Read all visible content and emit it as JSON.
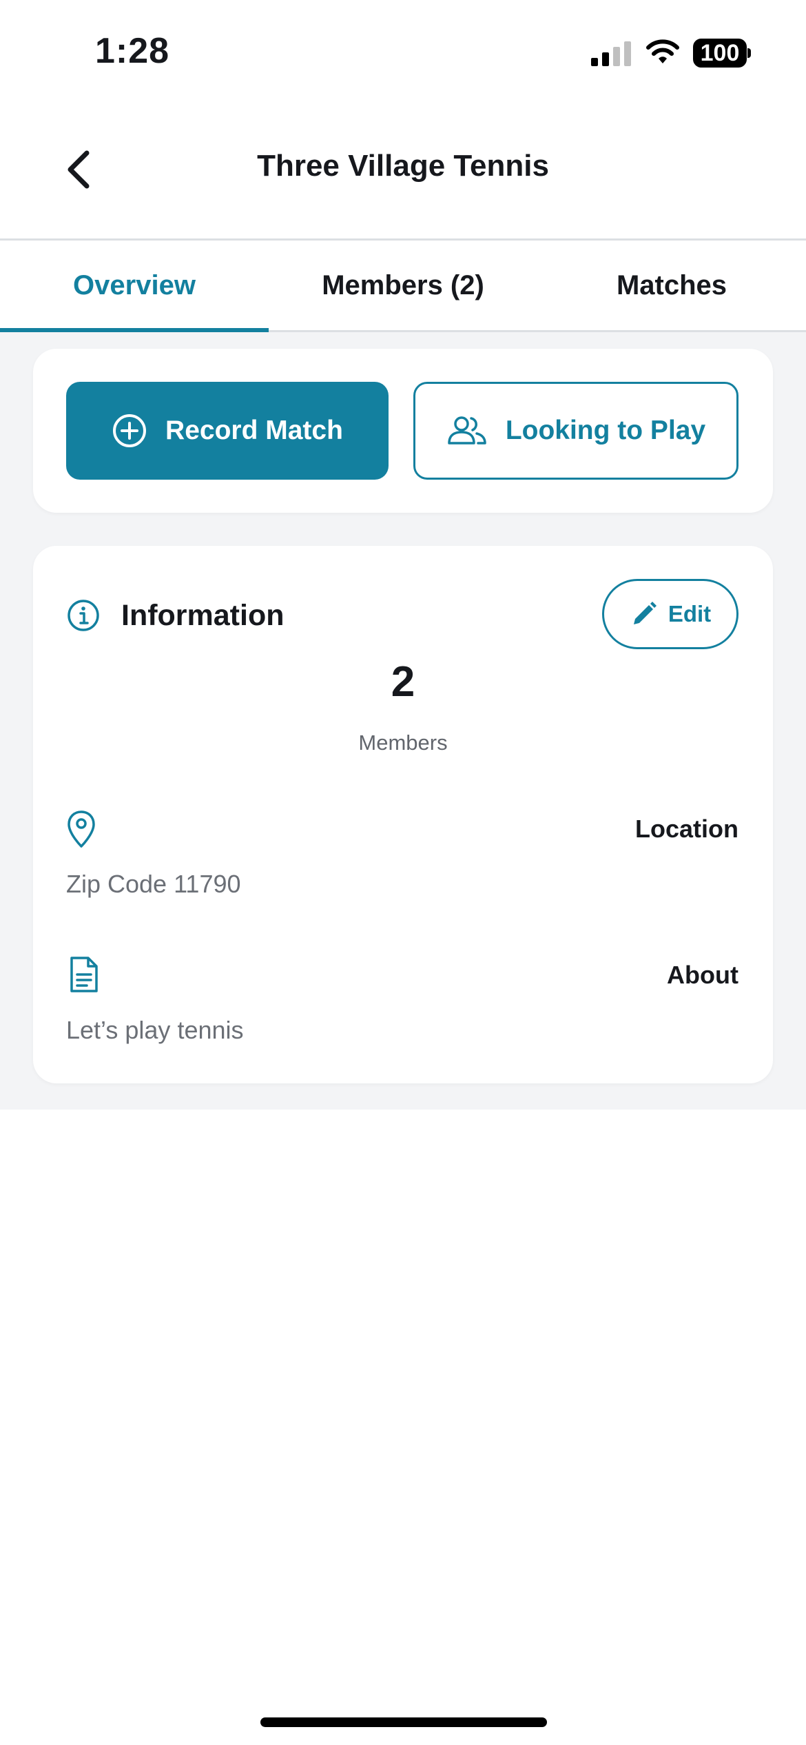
{
  "status_bar": {
    "time": "1:28",
    "battery": "100",
    "icons": [
      "signal-icon",
      "wifi-icon",
      "battery-icon"
    ]
  },
  "header": {
    "title": "Three Village Tennis",
    "back_icon": "chevron-left-icon"
  },
  "tabs": [
    {
      "label": "Overview",
      "active": true
    },
    {
      "label": "Members (2)",
      "active": false
    },
    {
      "label": "Matches",
      "active": false
    }
  ],
  "actions": {
    "record_match": {
      "label": "Record Match",
      "icon": "plus-circle-icon"
    },
    "looking_to_play": {
      "label": "Looking to Play",
      "icon": "users-icon"
    }
  },
  "information": {
    "title": "Information",
    "edit_label": "Edit",
    "member_count": "2",
    "member_label": "Members",
    "location_heading": "Location",
    "location_value": "Zip Code 11790",
    "about_heading": "About",
    "about_value": "Let’s play tennis"
  },
  "colors": {
    "accent": "#13809f",
    "background": "#f3f4f6",
    "text": "#16181d",
    "muted": "#6b6f76"
  }
}
